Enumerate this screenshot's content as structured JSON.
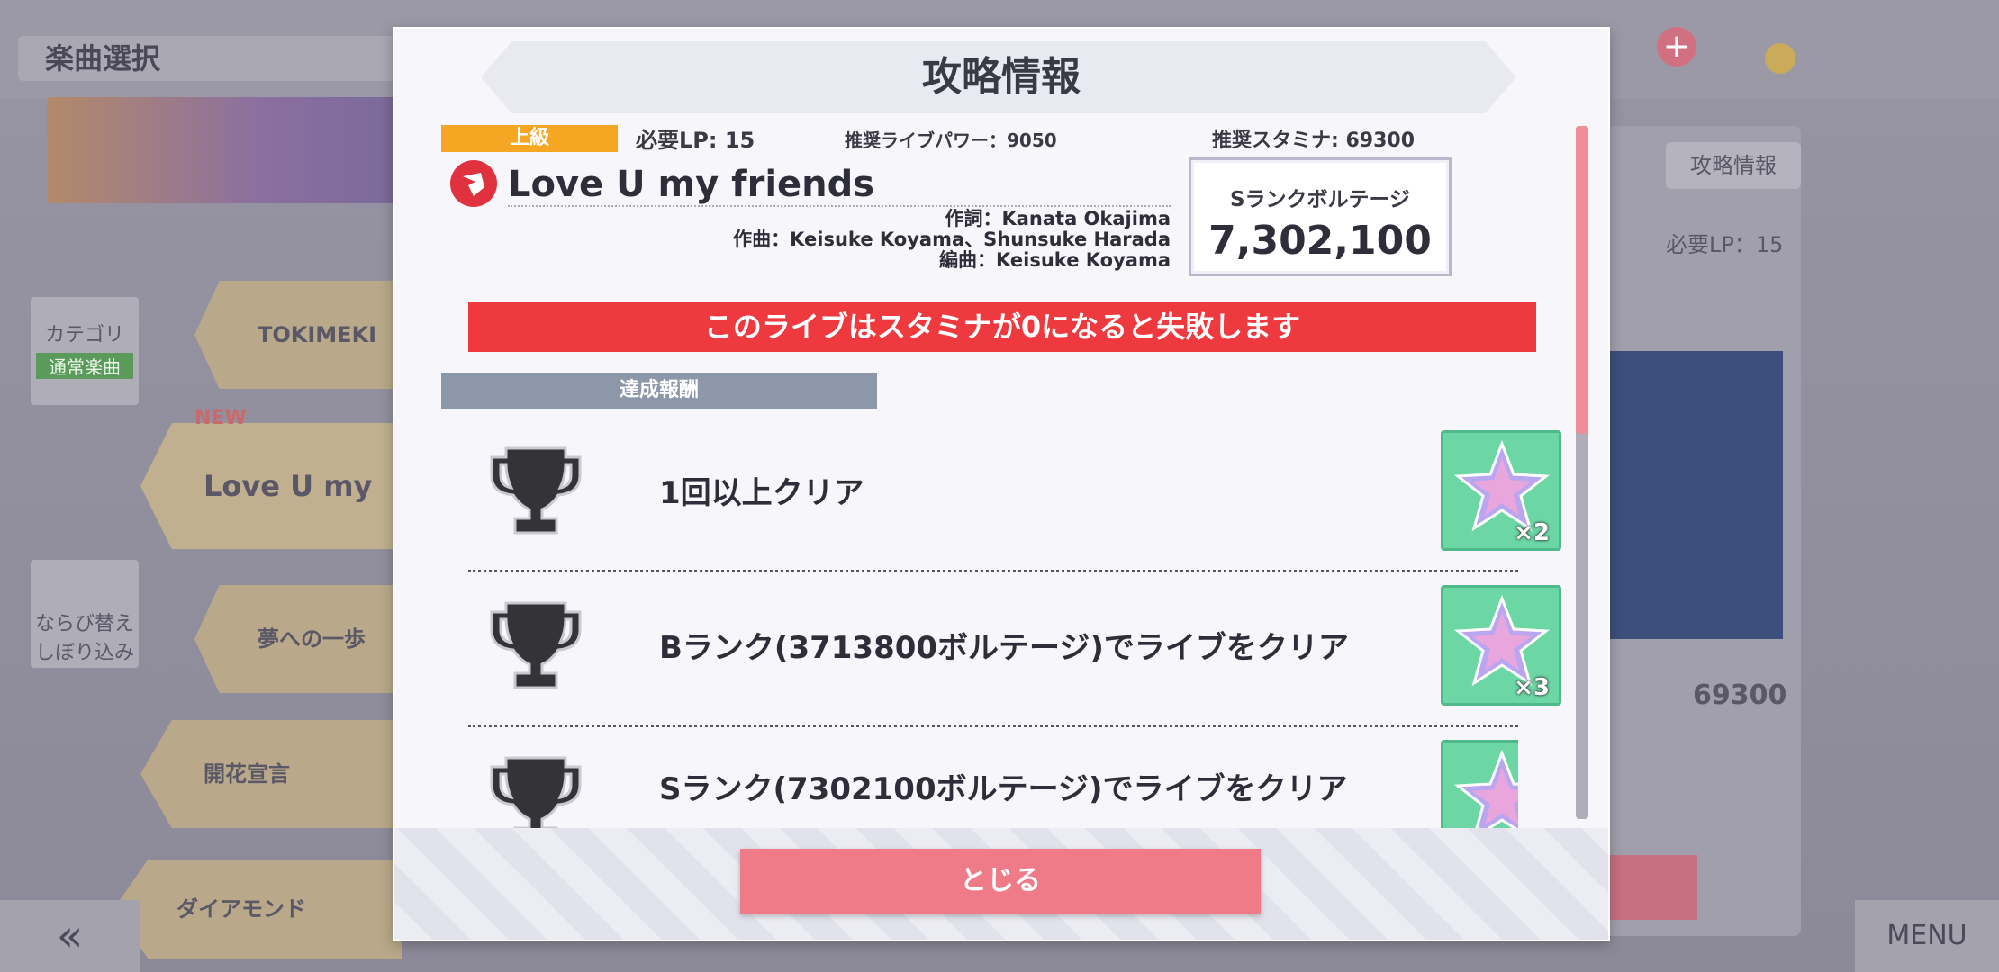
{
  "background": {
    "screen_title": "楽曲選択",
    "category_label": "カテゴリ",
    "category_value": "通常楽曲",
    "sort_label": "ならび替え\nしぼり込み",
    "songs": [
      {
        "name": "TOKIMEKI Run"
      },
      {
        "name": "Love U my fri"
      },
      {
        "name": "夢への一歩"
      },
      {
        "name": "開花宣言"
      },
      {
        "name": "ダイアモンド"
      }
    ],
    "new_badge": "NEW",
    "right_panel_button": "攻略情報",
    "right_panel_lp": "必要LP：15",
    "right_panel_stamina": "69300",
    "back_button": "«",
    "menu_button": "MENU",
    "add_button": "+"
  },
  "modal": {
    "title": "攻略情報",
    "difficulty": "上級",
    "required_lp": "必要LP: 15",
    "recommended_power": "推奨ライブパワー：9050",
    "recommended_stamina": "推奨スタミナ: 69300",
    "song_title": "Love U my friends",
    "lyrics": "作詞：Kanata Okajima",
    "composer": "作曲：Keisuke Koyama、Shunsuke Harada",
    "arranger": "編曲：Keisuke Koyama",
    "voltage_label": "Sランクボルテージ",
    "voltage_value": "7,302,100",
    "warning": "このライブはスタミナが0になると失敗します",
    "rewards_label": "達成報酬",
    "rewards": [
      {
        "text": "1回以上クリア",
        "qty": "×2"
      },
      {
        "text": "Bランク(3713800ボルテージ)でライブをクリア",
        "qty": "×3"
      },
      {
        "text": "Sランク(7302100ボルテージ)でライブをクリア",
        "qty": ""
      }
    ],
    "close_button": "とじる",
    "scroll_position": 0.0
  },
  "colors": {
    "difficulty_orange": "#f5a623",
    "warning_red": "#ee3a3e",
    "close_pink": "#f07b88",
    "item_green": "#6cd6a4",
    "song_icon_red": "#e0323e"
  },
  "icons": {
    "trophy": "trophy-icon",
    "reward_item": "star-gem-icon",
    "song_attribute": "attribute-icon"
  }
}
